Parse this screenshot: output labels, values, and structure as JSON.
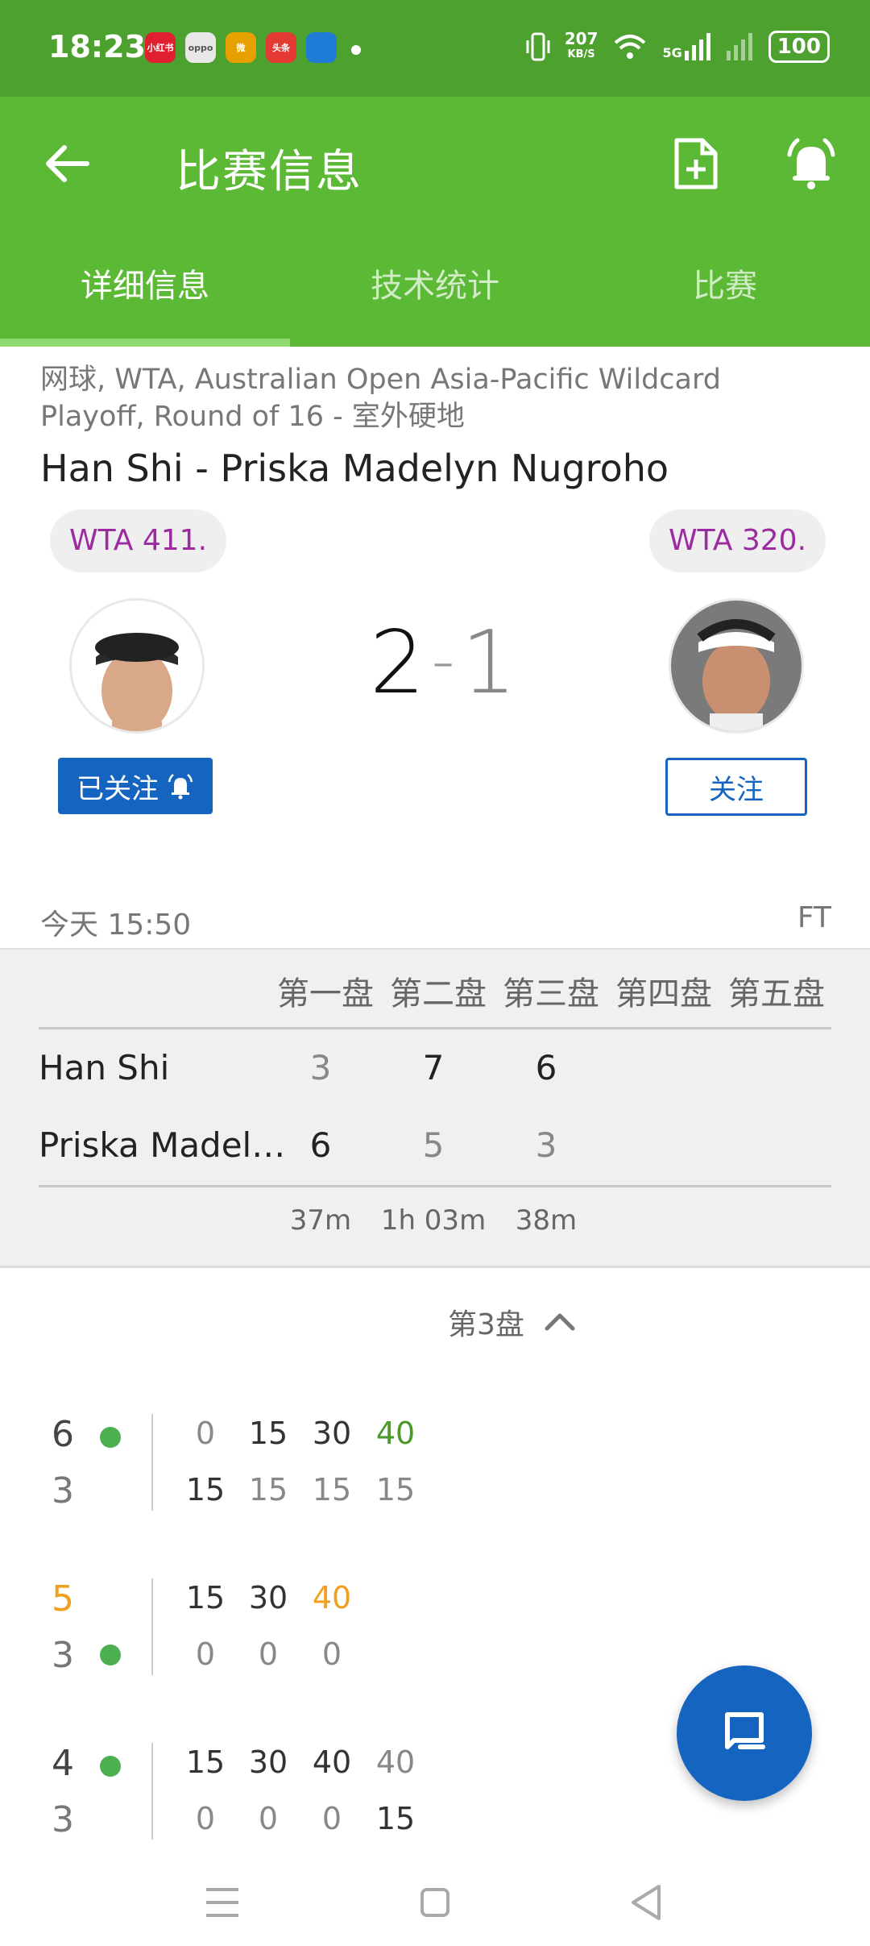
{
  "status_bar": {
    "time": "18:23",
    "apps": [
      {
        "icon": "xiaohongshu-icon",
        "label": "小红书",
        "color": "#e02030"
      },
      {
        "icon": "oppo-icon",
        "label": "oppo",
        "color": "#dddddd"
      },
      {
        "icon": "weibo-icon",
        "label": "微",
        "color": "#e6a000"
      },
      {
        "icon": "toutiao-icon",
        "label": "头条",
        "color": "#e33a33"
      },
      {
        "icon": "app-icon",
        "label": "",
        "color": "#1e7cd8"
      }
    ],
    "net_speed": "207",
    "net_unit": "KB/S",
    "signal_label": "5G",
    "battery": "100"
  },
  "appbar": {
    "title": "比赛信息"
  },
  "tabs": [
    "详细信息",
    "技术统计",
    "比赛"
  ],
  "match": {
    "meta": "网球, WTA, Australian Open Asia-Pacific Wildcard Playoff, Round of 16 - 室外硬地",
    "name": "Han Shi - Priska Madelyn Nugroho",
    "player1_rank": "WTA 411.",
    "player2_rank": "WTA 320.",
    "score_left": "2",
    "score_sep": "-",
    "score_right": "1",
    "follow_btn1": "已关注",
    "follow_btn2": "关注",
    "datetime": "今天 15:50",
    "status": "FT"
  },
  "score_table": {
    "headers": [
      "第一盘",
      "第二盘",
      "第三盘",
      "第四盘",
      "第五盘"
    ],
    "rows": [
      {
        "name": "Han Shi",
        "sets": [
          "3",
          "7",
          "6"
        ]
      },
      {
        "name": "Priska Madel…",
        "sets": [
          "6",
          "5",
          "3"
        ]
      }
    ],
    "durations": [
      "37m",
      "1h 03m",
      "38m"
    ]
  },
  "set_selector": "第3盘",
  "games": [
    {
      "top_score": "6",
      "bottom_score": "3",
      "server": "top",
      "top_pts": [
        "0",
        "15",
        "30",
        "40"
      ],
      "bottom_pts": [
        "15",
        "15",
        "15",
        "15"
      ]
    },
    {
      "top_score": "5",
      "bottom_score": "3",
      "server": "bottom",
      "top_pts": [
        "15",
        "30",
        "40"
      ],
      "bottom_pts": [
        "0",
        "0",
        "0"
      ]
    },
    {
      "top_score": "4",
      "bottom_score": "3",
      "server": "top",
      "top_pts": [
        "15",
        "30",
        "40",
        "40"
      ],
      "bottom_pts": [
        "0",
        "0",
        "0",
        "15"
      ]
    }
  ],
  "colors": {
    "green": "#5cb935",
    "dark_green": "#4ca12f",
    "blue": "#1565c0",
    "purple": "#9c2aa0",
    "orange": "#f0a020"
  }
}
